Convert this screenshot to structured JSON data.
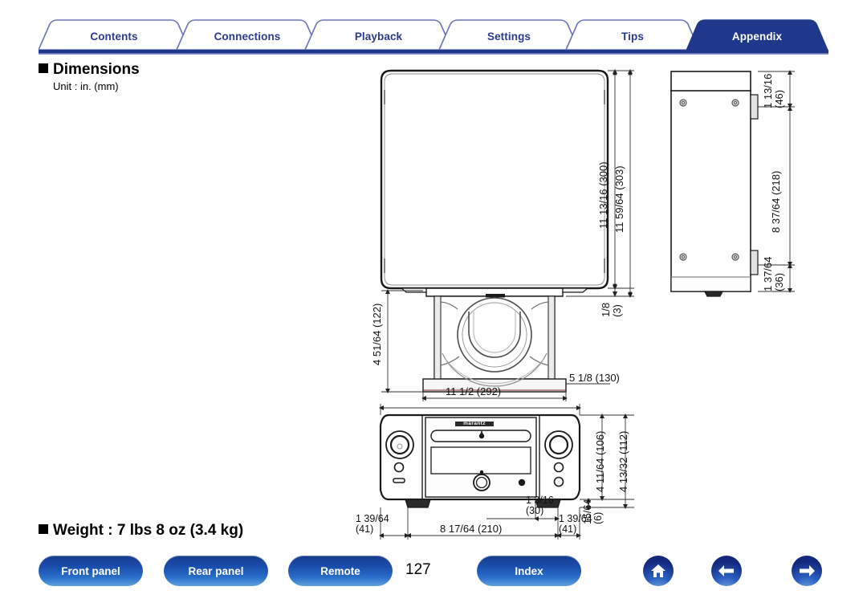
{
  "nav_tabs": [
    {
      "label": "Contents",
      "active": false
    },
    {
      "label": "Connections",
      "active": false
    },
    {
      "label": "Playback",
      "active": false
    },
    {
      "label": "Settings",
      "active": false
    },
    {
      "label": "Tips",
      "active": false
    },
    {
      "label": "Appendix",
      "active": true
    }
  ],
  "sections": {
    "dimensions_heading": "Dimensions",
    "unit_note": "Unit : in. (mm)",
    "weight_heading": "Weight : 7 lbs 8 oz (3.4 kg)"
  },
  "dimensions": {
    "front_height_inner": "11 13/16 (300)",
    "front_height_outer": "11 59/64 (303)",
    "front_foot_gap": "1/8\n(3)",
    "stand_height": "4 51/64 (122)",
    "stand_depth": "5 1/8 (130)",
    "unit_width": "11 1/2 (292)",
    "side_top": "1 13/16\n(46)",
    "side_mid": "8 37/64 (218)",
    "side_bottom": "1 37/64\n(36)",
    "panel_height_inner": "4 11/64 (106)",
    "panel_height_outer": "4 13/32 (112)",
    "panel_foot_left": "1 39/64\n(41)",
    "panel_foot_right": "1 39/64\n(41)",
    "panel_body_width": "8 17/64 (210)",
    "panel_knob_offset": "1 3/16\n(30)",
    "panel_foot_height": "15/64\n(6)"
  },
  "brand_text": "marantz",
  "footer": {
    "buttons": [
      {
        "label": "Front panel"
      },
      {
        "label": "Rear panel"
      },
      {
        "label": "Remote"
      },
      {
        "label": "Index"
      }
    ],
    "page_number": "127",
    "icons": [
      {
        "name": "home-icon"
      },
      {
        "name": "arrow-left-icon"
      },
      {
        "name": "arrow-right-icon"
      }
    ]
  },
  "colors": {
    "tab_active_bg": "#20388c",
    "tab_text": "#2b3a8f",
    "tab_border": "#6a74b8",
    "tab_underline": "#20388c",
    "button_gradient_top": "#173a8e",
    "button_gradient_bottom": "#5fa0dd"
  }
}
